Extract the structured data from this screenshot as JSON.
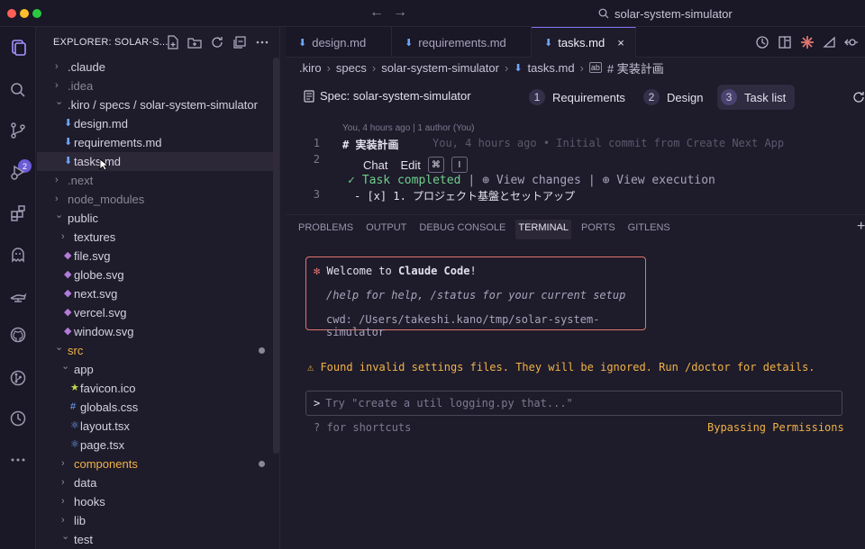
{
  "window": {
    "title": "solar-system-simulator"
  },
  "activity_bar": {
    "scm_badge": "2",
    "items": [
      "explorer-icon",
      "search-icon",
      "source-control-icon",
      "run-debug-icon",
      "extensions-icon",
      "ghost-icon",
      "github-icon",
      "lamp-icon",
      "git-graph-icon",
      "timeline-icon",
      "more-icon"
    ]
  },
  "sidebar": {
    "header": "EXPLORER: SOLAR-S...",
    "tree": [
      {
        "label": ".claude",
        "kind": "folder",
        "depth": 0,
        "open": false
      },
      {
        "label": ".idea",
        "kind": "folder",
        "depth": 0,
        "open": false,
        "dim": true
      },
      {
        "label": ".kiro / specs / solar-system-simulator",
        "kind": "folder",
        "depth": 0,
        "open": true
      },
      {
        "label": "design.md",
        "kind": "md",
        "depth": 1
      },
      {
        "label": "requirements.md",
        "kind": "md",
        "depth": 1
      },
      {
        "label": "tasks.md",
        "kind": "md",
        "depth": 1,
        "selected": true
      },
      {
        "label": ".next",
        "kind": "folder",
        "depth": 0,
        "open": false,
        "dim": true
      },
      {
        "label": "node_modules",
        "kind": "folder",
        "depth": 0,
        "open": false,
        "dim": true
      },
      {
        "label": "public",
        "kind": "folder",
        "depth": 0,
        "open": true
      },
      {
        "label": "textures",
        "kind": "folder",
        "depth": 1,
        "open": false
      },
      {
        "label": "file.svg",
        "kind": "svg",
        "depth": 1
      },
      {
        "label": "globe.svg",
        "kind": "svg",
        "depth": 1
      },
      {
        "label": "next.svg",
        "kind": "svg",
        "depth": 1
      },
      {
        "label": "vercel.svg",
        "kind": "svg",
        "depth": 1
      },
      {
        "label": "window.svg",
        "kind": "svg",
        "depth": 1
      },
      {
        "label": "src",
        "kind": "folder",
        "depth": 0,
        "open": true,
        "accent": true,
        "dot": true
      },
      {
        "label": "app",
        "kind": "folder",
        "depth": 1,
        "open": true
      },
      {
        "label": "favicon.ico",
        "kind": "ico",
        "depth": 2
      },
      {
        "label": "globals.css",
        "kind": "css",
        "depth": 2
      },
      {
        "label": "layout.tsx",
        "kind": "tsx",
        "depth": 2
      },
      {
        "label": "page.tsx",
        "kind": "tsx",
        "depth": 2
      },
      {
        "label": "components",
        "kind": "folder",
        "depth": 1,
        "open": false,
        "accent": true,
        "dot": true
      },
      {
        "label": "data",
        "kind": "folder",
        "depth": 1,
        "open": false
      },
      {
        "label": "hooks",
        "kind": "folder",
        "depth": 1,
        "open": false
      },
      {
        "label": "lib",
        "kind": "folder",
        "depth": 1,
        "open": false
      },
      {
        "label": "test",
        "kind": "folder",
        "depth": 1,
        "open": true
      }
    ]
  },
  "tabs": [
    {
      "label": "design.md",
      "active": false
    },
    {
      "label": "requirements.md",
      "active": false
    },
    {
      "label": "tasks.md",
      "active": true,
      "close": "×"
    }
  ],
  "breadcrumb": {
    "items": [
      ".kiro",
      "specs",
      "solar-system-simulator",
      "tasks.md",
      "# 実装計画"
    ]
  },
  "spec": {
    "title": "Spec: solar-system-simulator",
    "steps": [
      {
        "num": "1",
        "label": "Requirements",
        "active": false
      },
      {
        "num": "2",
        "label": "Design",
        "active": false
      },
      {
        "num": "3",
        "label": "Task list",
        "active": true
      }
    ]
  },
  "editor": {
    "blame": "You, 4 hours ago | 1 author (You)",
    "line1_no": "1",
    "line1": "# 実装計画",
    "line1_ghost": "You, 4 hours ago • Initial commit from Create Next App",
    "line2_no": "2",
    "line3_no": "3",
    "line3": "- [x] 1. プロジェクト基盤とセットアップ",
    "chat": "Chat",
    "edit": "Edit",
    "kbd1": "⌘",
    "kbd2": "I",
    "task_completed": "Task completed",
    "view_changes": "View changes",
    "view_execution": "View execution"
  },
  "panel": {
    "tabs": [
      "PROBLEMS",
      "OUTPUT",
      "DEBUG CONSOLE",
      "TERMINAL",
      "PORTS",
      "GITLENS"
    ],
    "active_tab": "TERMINAL",
    "welcome_prefix": "Welcome to ",
    "welcome_name": "Claude Code",
    "welcome_suffix": "!",
    "help": "/help for help, /status for your current setup",
    "cwd": "cwd: /Users/takeshi.kano/tmp/solar-system-simulator",
    "warning": "⚠ Found invalid settings files. They will be ignored. Run /doctor for details.",
    "prompt_placeholder": "Try \"create a util logging.py that...\"",
    "shortcuts": "? for shortcuts",
    "bypass": "Bypassing Permissions"
  },
  "colors": {
    "accent": "#7c6ff0",
    "folder_accent": "#f0b347",
    "md_icon": "#6fa8ff",
    "svg_icon": "#b27bd9",
    "claude_orange": "#e0756f",
    "success": "#6fd08c"
  }
}
